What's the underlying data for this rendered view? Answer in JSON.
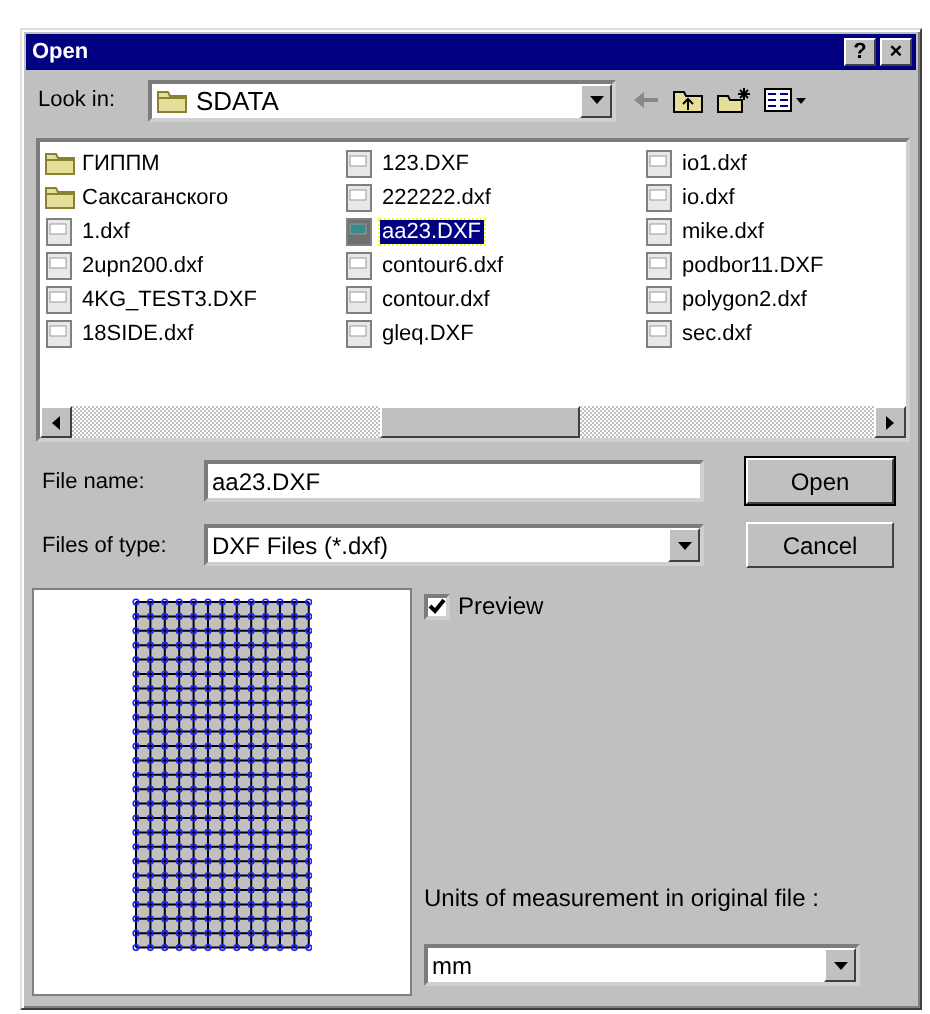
{
  "window": {
    "title": "Open",
    "buttons": [
      "?",
      "×"
    ]
  },
  "look_in": {
    "label": "Look in:",
    "value": "SDATA"
  },
  "files": [
    {
      "name": "ГИППМ",
      "kind": "folder",
      "selected": false
    },
    {
      "name": "Саксаганского",
      "kind": "folder",
      "selected": false
    },
    {
      "name": "1.dxf",
      "kind": "dxf",
      "selected": false
    },
    {
      "name": "2upn200.dxf",
      "kind": "dxf",
      "selected": false
    },
    {
      "name": "4KG_TEST3.DXF",
      "kind": "dxf",
      "selected": false
    },
    {
      "name": "18SIDE.dxf",
      "kind": "dxf",
      "selected": false
    },
    {
      "name": "123.DXF",
      "kind": "dxf",
      "selected": false
    },
    {
      "name": "222222.dxf",
      "kind": "dxf",
      "selected": false
    },
    {
      "name": "aa23.DXF",
      "kind": "dxf",
      "selected": true
    },
    {
      "name": "contour6.dxf",
      "kind": "dxf",
      "selected": false
    },
    {
      "name": "contour.dxf",
      "kind": "dxf",
      "selected": false
    },
    {
      "name": "gleq.DXF",
      "kind": "dxf",
      "selected": false
    },
    {
      "name": "io1.dxf",
      "kind": "dxf",
      "selected": false
    },
    {
      "name": "io.dxf",
      "kind": "dxf",
      "selected": false
    },
    {
      "name": "mike.dxf",
      "kind": "dxf",
      "selected": false
    },
    {
      "name": "podbor11.DXF",
      "kind": "dxf",
      "selected": false
    },
    {
      "name": "polygon2.dxf",
      "kind": "dxf",
      "selected": false
    },
    {
      "name": "sec.dxf",
      "kind": "dxf",
      "selected": false
    }
  ],
  "file_name": {
    "label": "File name:",
    "value": "aa23.DXF"
  },
  "files_of_type": {
    "label": "Files of type:",
    "value": "DXF Files (*.dxf)"
  },
  "buttons": [
    "Open",
    "Cancel"
  ],
  "preview": {
    "label": "Preview",
    "checked": true
  },
  "units": {
    "label": "Units of measurement in original file :",
    "value": "mm"
  }
}
